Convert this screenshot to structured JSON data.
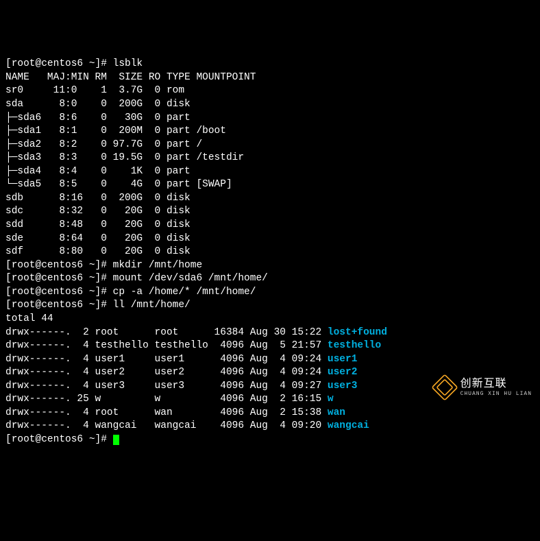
{
  "prompt": {
    "user": "root",
    "host": "centos6",
    "cwd": "~",
    "symbol": "#"
  },
  "commands": {
    "lsblk": "lsblk",
    "mkdir": "mkdir /mnt/home",
    "mount": "mount /dev/sda6 /mnt/home/",
    "cp": "cp -a /home/* /mnt/home/",
    "ll": "ll /mnt/home/"
  },
  "lsblk_header": "NAME   MAJ:MIN RM  SIZE RO TYPE MOUNTPOINT",
  "lsblk_rows": [
    {
      "name_col": "sr0     11:0    1  3.7G  0 rom  "
    },
    {
      "name_col": "sda      8:0    0  200G  0 disk "
    },
    {
      "name_col": "├─sda6   8:6    0   30G  0 part "
    },
    {
      "name_col": "├─sda1   8:1    0  200M  0 part /boot"
    },
    {
      "name_col": "├─sda2   8:2    0 97.7G  0 part /"
    },
    {
      "name_col": "├─sda3   8:3    0 19.5G  0 part /testdir"
    },
    {
      "name_col": "├─sda4   8:4    0    1K  0 part "
    },
    {
      "name_col": "└─sda5   8:5    0    4G  0 part [SWAP]"
    },
    {
      "name_col": "sdb      8:16   0  200G  0 disk "
    },
    {
      "name_col": "sdc      8:32   0   20G  0 disk "
    },
    {
      "name_col": "sdd      8:48   0   20G  0 disk "
    },
    {
      "name_col": "sde      8:64   0   20G  0 disk "
    },
    {
      "name_col": "sdf      8:80   0   20G  0 disk "
    }
  ],
  "ll_total": "total 44",
  "ll_rows": [
    {
      "perms": "drwx------.  2 root      root      16384 Aug 30 15:22 ",
      "fname": "lost+found"
    },
    {
      "perms": "drwx------.  4 testhello testhello  4096 Aug  5 21:57 ",
      "fname": "testhello"
    },
    {
      "perms": "drwx------.  4 user1     user1      4096 Aug  4 09:24 ",
      "fname": "user1"
    },
    {
      "perms": "drwx------.  4 user2     user2      4096 Aug  4 09:24 ",
      "fname": "user2"
    },
    {
      "perms": "drwx------.  4 user3     user3      4096 Aug  4 09:27 ",
      "fname": "user3"
    },
    {
      "perms": "drwx------. 25 w         w          4096 Aug  2 16:15 ",
      "fname": "w"
    },
    {
      "perms": "drwx------.  4 root      wan        4096 Aug  2 15:38 ",
      "fname": "wan"
    },
    {
      "perms": "drwx------.  4 wangcai   wangcai    4096 Aug  4 09:20 ",
      "fname": "wangcai"
    }
  ],
  "watermark": {
    "cn": "创新互联",
    "en": "CHUANG XIN HU LIAN"
  }
}
